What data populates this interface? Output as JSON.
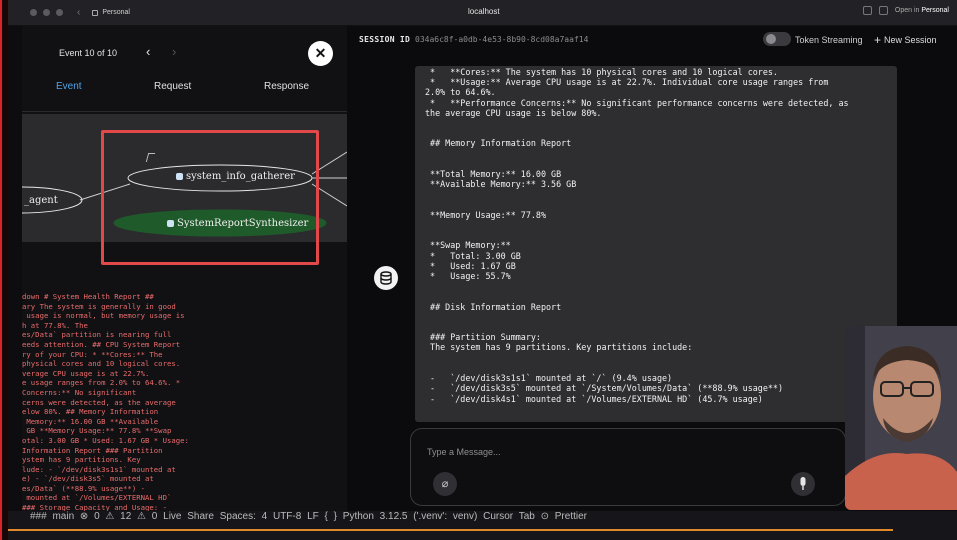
{
  "browser": {
    "profile": "Personal",
    "url": "localhost",
    "open_in_prefix": "Open in",
    "open_in_profile": "Personal"
  },
  "trace_panel": {
    "event_counter": "Event 10 of 10",
    "prev_icon": "chevron-left-icon",
    "next_icon": "chevron-right-icon",
    "close_icon": "close-icon",
    "tabs": [
      "Event",
      "Request",
      "Response"
    ],
    "active_tab": "Event",
    "graph": {
      "nodes": [
        "_agent",
        "system_info_gatherer",
        "SystemReportSynthesizer"
      ]
    },
    "log_lines": [
      "down # System Health Report ##",
      "ary The system is generally in good",
      " usage is normal, but memory usage is",
      "h at 77.8%. The",
      "es/Data` partition is nearing full",
      "eeds attention. ## CPU System Report",
      "ry of your CPU: * **Cores:** The",
      "physical cores and 10 logical cores.",
      "verage CPU usage is at 22.7%.",
      "e usage ranges from 2.0% to 64.6%. *",
      "Concerns:** No significant",
      "cerns were detected, as the average",
      "elow 80%. ## Memory Information",
      " Memory:** 16.00 GB **Available",
      " GB **Memory Usage:** 77.8% **Swap",
      "otal: 3.00 GB * Used: 1.67 GB * Usage:",
      "Information Report ### Partition",
      "ystem has 9 partitions. Key",
      "lude: - `/dev/disk3s1s1` mounted at",
      "e) - `/dev/disk3s5` mounted at",
      "es/Data` (**88.9% usage**) -",
      " mounted at `/Volumes/EXTERNAL HD`",
      "### Storage Capacity and Usage: -"
    ]
  },
  "session": {
    "label": "SESSION ID",
    "id": "034a6c8f-a0db-4e53-8b90-8cd08a7aaf14",
    "token_streaming": "Token Streaming",
    "new_session": "New Session"
  },
  "chat": {
    "lines": [
      " *   **Cores:** The system has 10 physical cores and 10 logical cores.",
      " *   **Usage:** Average CPU usage is at 22.7%. Individual core usage ranges from",
      "2.0% to 64.6%.",
      " *   **Performance Concerns:** No significant performance concerns were detected, as",
      "the average CPU usage is below 80%.",
      "",
      "",
      " ## Memory Information Report",
      "",
      "",
      " **Total Memory:** 16.00 GB",
      " **Available Memory:** 3.56 GB",
      "",
      "",
      " **Memory Usage:** 77.8%",
      "",
      "",
      " **Swap Memory:**",
      " *   Total: 3.00 GB",
      " *   Used: 1.67 GB",
      " *   Usage: 55.7%",
      "",
      "",
      " ## Disk Information Report",
      "",
      "",
      " ### Partition Summary:",
      " The system has 9 partitions. Key partitions include:",
      "",
      "",
      " -   `/dev/disk3s1s1` mounted at `/` (9.4% usage)",
      " -   `/dev/disk3s5` mounted at `/System/Volumes/Data` (**88.9% usage**)",
      " -   `/dev/disk4s1` mounted at `/Volumes/EXTERNAL HD` (45.7% usage)"
    ],
    "input_placeholder": "Type a Message...",
    "attach_icon": "paperclip-icon",
    "mic_icon": "microphone-icon",
    "db_icon": "database-icon"
  },
  "statusbar": {
    "text": "### main ⊗ 0 ⚠ 12   ⚠ 0   Live Share   Spaces: 4   UTF-8   LF   { } Python   3.12.5 ('.venv': venv)   Cursor Tab   ⊙ Prettier"
  },
  "colors": {
    "accent_blue": "#4fa3e8",
    "highlight_red": "#e0484a",
    "log_red": "#ea6b6b",
    "node_green": "#1f5a2a"
  }
}
